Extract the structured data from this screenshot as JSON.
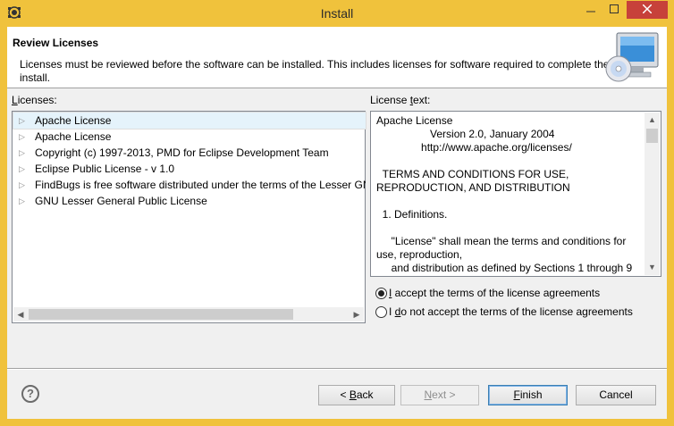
{
  "window": {
    "title": "Install",
    "controls": {
      "minimize": "minimize-icon",
      "maximize": "maximize-icon",
      "close": "close-icon"
    }
  },
  "header": {
    "title": "Review Licenses",
    "description": "Licenses must be reviewed before the software can be installed.  This includes licenses for software required to complete the install."
  },
  "licenses_panel": {
    "label_mnemonic": "L",
    "label_rest": "icenses:",
    "items": [
      {
        "label": "Apache License",
        "selected": true
      },
      {
        "label": "Apache License"
      },
      {
        "label": "Copyright (c) 1997-2013, PMD for Eclipse Development Team"
      },
      {
        "label": "Eclipse Public License - v 1.0"
      },
      {
        "label": "FindBugs is free software distributed under the terms of the Lesser GNU"
      },
      {
        "label": "GNU Lesser General Public License"
      }
    ]
  },
  "license_text_panel": {
    "label_pre": "License ",
    "label_mnemonic": "t",
    "label_post": "ext:",
    "lines": [
      "Apache License",
      "                  Version 2.0, January 2004",
      "               http://www.apache.org/licenses/",
      "",
      "  TERMS AND CONDITIONS FOR USE, REPRODUCTION, AND DISTRIBUTION",
      "",
      "  1. Definitions.",
      "",
      "     \"License\" shall mean the terms and conditions for use, reproduction,",
      "     and distribution as defined by Sections 1 through 9"
    ]
  },
  "agreement": {
    "accept": {
      "mnemonic": "I",
      "rest": " accept the terms of the license agreements",
      "checked": true
    },
    "decline": {
      "pre": "I ",
      "mnemonic": "d",
      "rest": "o not accept the terms of the license agreements",
      "checked": false
    }
  },
  "buttons": {
    "back": {
      "pre": "< ",
      "mnemonic": "B",
      "rest": "ack"
    },
    "next": {
      "mnemonic": "N",
      "rest": "ext >",
      "disabled": true
    },
    "finish": {
      "mnemonic": "F",
      "rest": "inish"
    },
    "cancel": "Cancel"
  },
  "colors": {
    "title_bar": "#f0c23c",
    "close_button": "#c7413a",
    "selection": "#e5f3fb"
  }
}
